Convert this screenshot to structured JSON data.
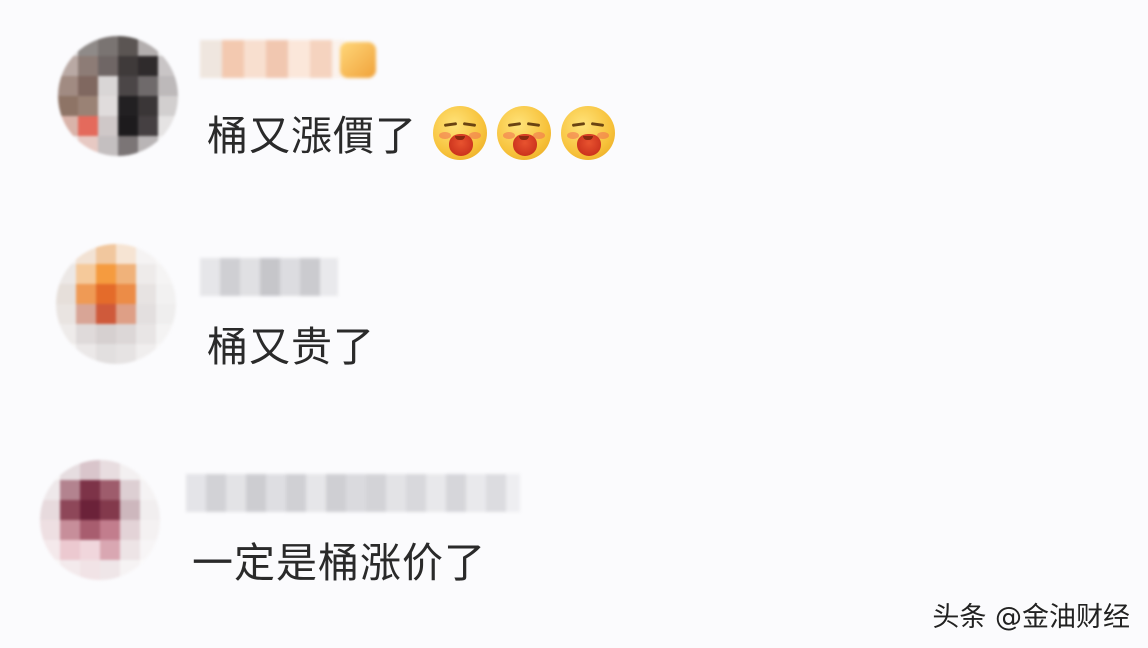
{
  "comments": [
    {
      "text": "桶又漲價了",
      "emoji_count": 3,
      "emoji_icon": "blush-face-hand-emoji"
    },
    {
      "text": "桶又贵了"
    },
    {
      "text": "一定是桶涨价了"
    }
  ],
  "watermark": "头条 @金油财经"
}
